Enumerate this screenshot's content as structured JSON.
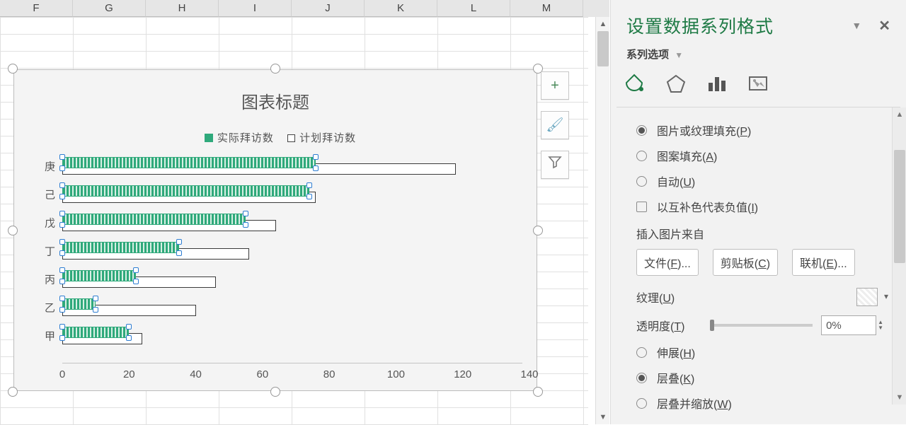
{
  "columns": [
    "F",
    "G",
    "H",
    "I",
    "J",
    "K",
    "L",
    "M"
  ],
  "chart_data": {
    "type": "bar",
    "orientation": "horizontal",
    "title": "图表标题",
    "xlim": [
      0,
      140
    ],
    "x_ticks": [
      0,
      20,
      40,
      60,
      80,
      100,
      120,
      140
    ],
    "categories": [
      "庚",
      "己",
      "戊",
      "丁",
      "丙",
      "乙",
      "甲"
    ],
    "series": [
      {
        "name": "实际拜访数",
        "values": [
          76,
          74,
          55,
          35,
          22,
          10,
          20
        ]
      },
      {
        "name": "计划拜访数",
        "values": [
          118,
          76,
          64,
          56,
          46,
          40,
          24
        ]
      }
    ]
  },
  "chart_buttons": {
    "add": "+",
    "brush": "🖌",
    "filter": "⧩"
  },
  "pane": {
    "title": "设置数据系列格式",
    "subtitle": "系列选项",
    "fill_options": {
      "picture_texture": "图片或纹理填充(P)",
      "pattern": "图案填充(A)",
      "auto": "自动(U)",
      "invert_neg": "以互补色代表负值(I)",
      "selected": "picture_texture"
    },
    "insert_from": {
      "label": "插入图片来自",
      "file": "文件(F)...",
      "clipboard": "剪贴板(C)",
      "online": "联机(E)..."
    },
    "texture_label": "纹理(U)",
    "transparency": {
      "label": "透明度(T)",
      "value": "0%"
    },
    "stretch_group": {
      "stretch": "伸展(H)",
      "stack": "层叠(K)",
      "stack_scale": "层叠并缩放(W)",
      "selected": "stack"
    }
  }
}
